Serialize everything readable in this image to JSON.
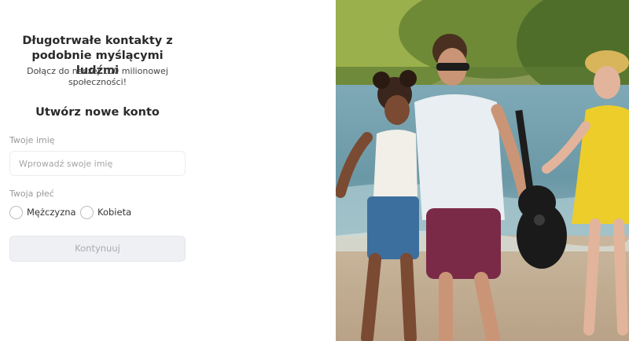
{
  "intro": {
    "headline_line1": "Długotrwałe kontakty z",
    "headline_line2": "podobnie myślącymi ludźmi",
    "sub_line1": "Dołącz do naszej 100 milionowej",
    "sub_line2": "społeczności!"
  },
  "form": {
    "title": "Utwórz nowe konto",
    "name_label": "Twoje imię",
    "name_placeholder": "Wprowadź swoje imię",
    "name_value": "",
    "gender_label": "Twoja płeć",
    "gender_options": [
      "Mężczyzna",
      "Kobieta"
    ],
    "continue_label": "Kontynuuj"
  },
  "hero": {
    "image": "photo-of-friends-walking-on-beach"
  }
}
